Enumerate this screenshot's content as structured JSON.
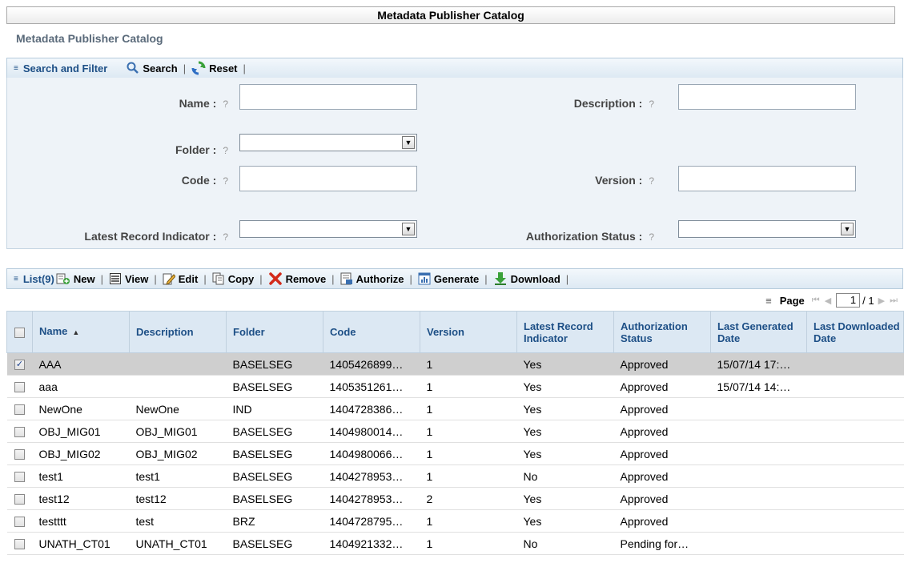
{
  "page": {
    "title": "Metadata Publisher Catalog",
    "subtitle": "Metadata Publisher Catalog"
  },
  "search": {
    "header": "Search and Filter",
    "search_label": "Search",
    "reset_label": "Reset"
  },
  "filters": {
    "name_label": "Name :",
    "description_label": "Description :",
    "folder_label": "Folder :",
    "code_label": "Code :",
    "version_label": "Version :",
    "latest_label": "Latest Record Indicator :",
    "auth_label": "Authorization Status :",
    "help": "?"
  },
  "list": {
    "header": "List(9)",
    "new": "New",
    "view": "View",
    "edit": "Edit",
    "copy": "Copy",
    "remove": "Remove",
    "authorize": "Authorize",
    "generate": "Generate",
    "download": "Download"
  },
  "pager": {
    "label": "Page",
    "current": "1",
    "total": "/ 1"
  },
  "table": {
    "columns": [
      "Name",
      "Description",
      "Folder",
      "Code",
      "Version",
      "Latest Record Indicator",
      "Authorization Status",
      "Last Generated Date",
      "Last Downloaded Date"
    ],
    "rows": [
      [
        "AAA",
        "",
        "BASELSEG",
        "1405426899…",
        "1",
        "Yes",
        "Approved",
        "15/07/14 17:…",
        ""
      ],
      [
        "aaa",
        "",
        "BASELSEG",
        "1405351261…",
        "1",
        "Yes",
        "Approved",
        "15/07/14 14:…",
        ""
      ],
      [
        "NewOne",
        "NewOne",
        "IND",
        "1404728386…",
        "1",
        "Yes",
        "Approved",
        "",
        ""
      ],
      [
        "OBJ_MIG01",
        "OBJ_MIG01",
        "BASELSEG",
        "1404980014…",
        "1",
        "Yes",
        "Approved",
        "",
        ""
      ],
      [
        "OBJ_MIG02",
        "OBJ_MIG02",
        "BASELSEG",
        "1404980066…",
        "1",
        "Yes",
        "Approved",
        "",
        ""
      ],
      [
        "test1",
        "test1",
        "BASELSEG",
        "1404278953…",
        "1",
        "No",
        "Approved",
        "",
        ""
      ],
      [
        "test12",
        "test12",
        "BASELSEG",
        "1404278953…",
        "2",
        "Yes",
        "Approved",
        "",
        ""
      ],
      [
        "testttt",
        "test",
        "BRZ",
        "1404728795…",
        "1",
        "Yes",
        "Approved",
        "",
        ""
      ],
      [
        "UNATH_CT01",
        "UNATH_CT01",
        "BASELSEG",
        "1404921332…",
        "1",
        "No",
        "Pending for…",
        "",
        ""
      ]
    ],
    "selected_row": 0
  }
}
